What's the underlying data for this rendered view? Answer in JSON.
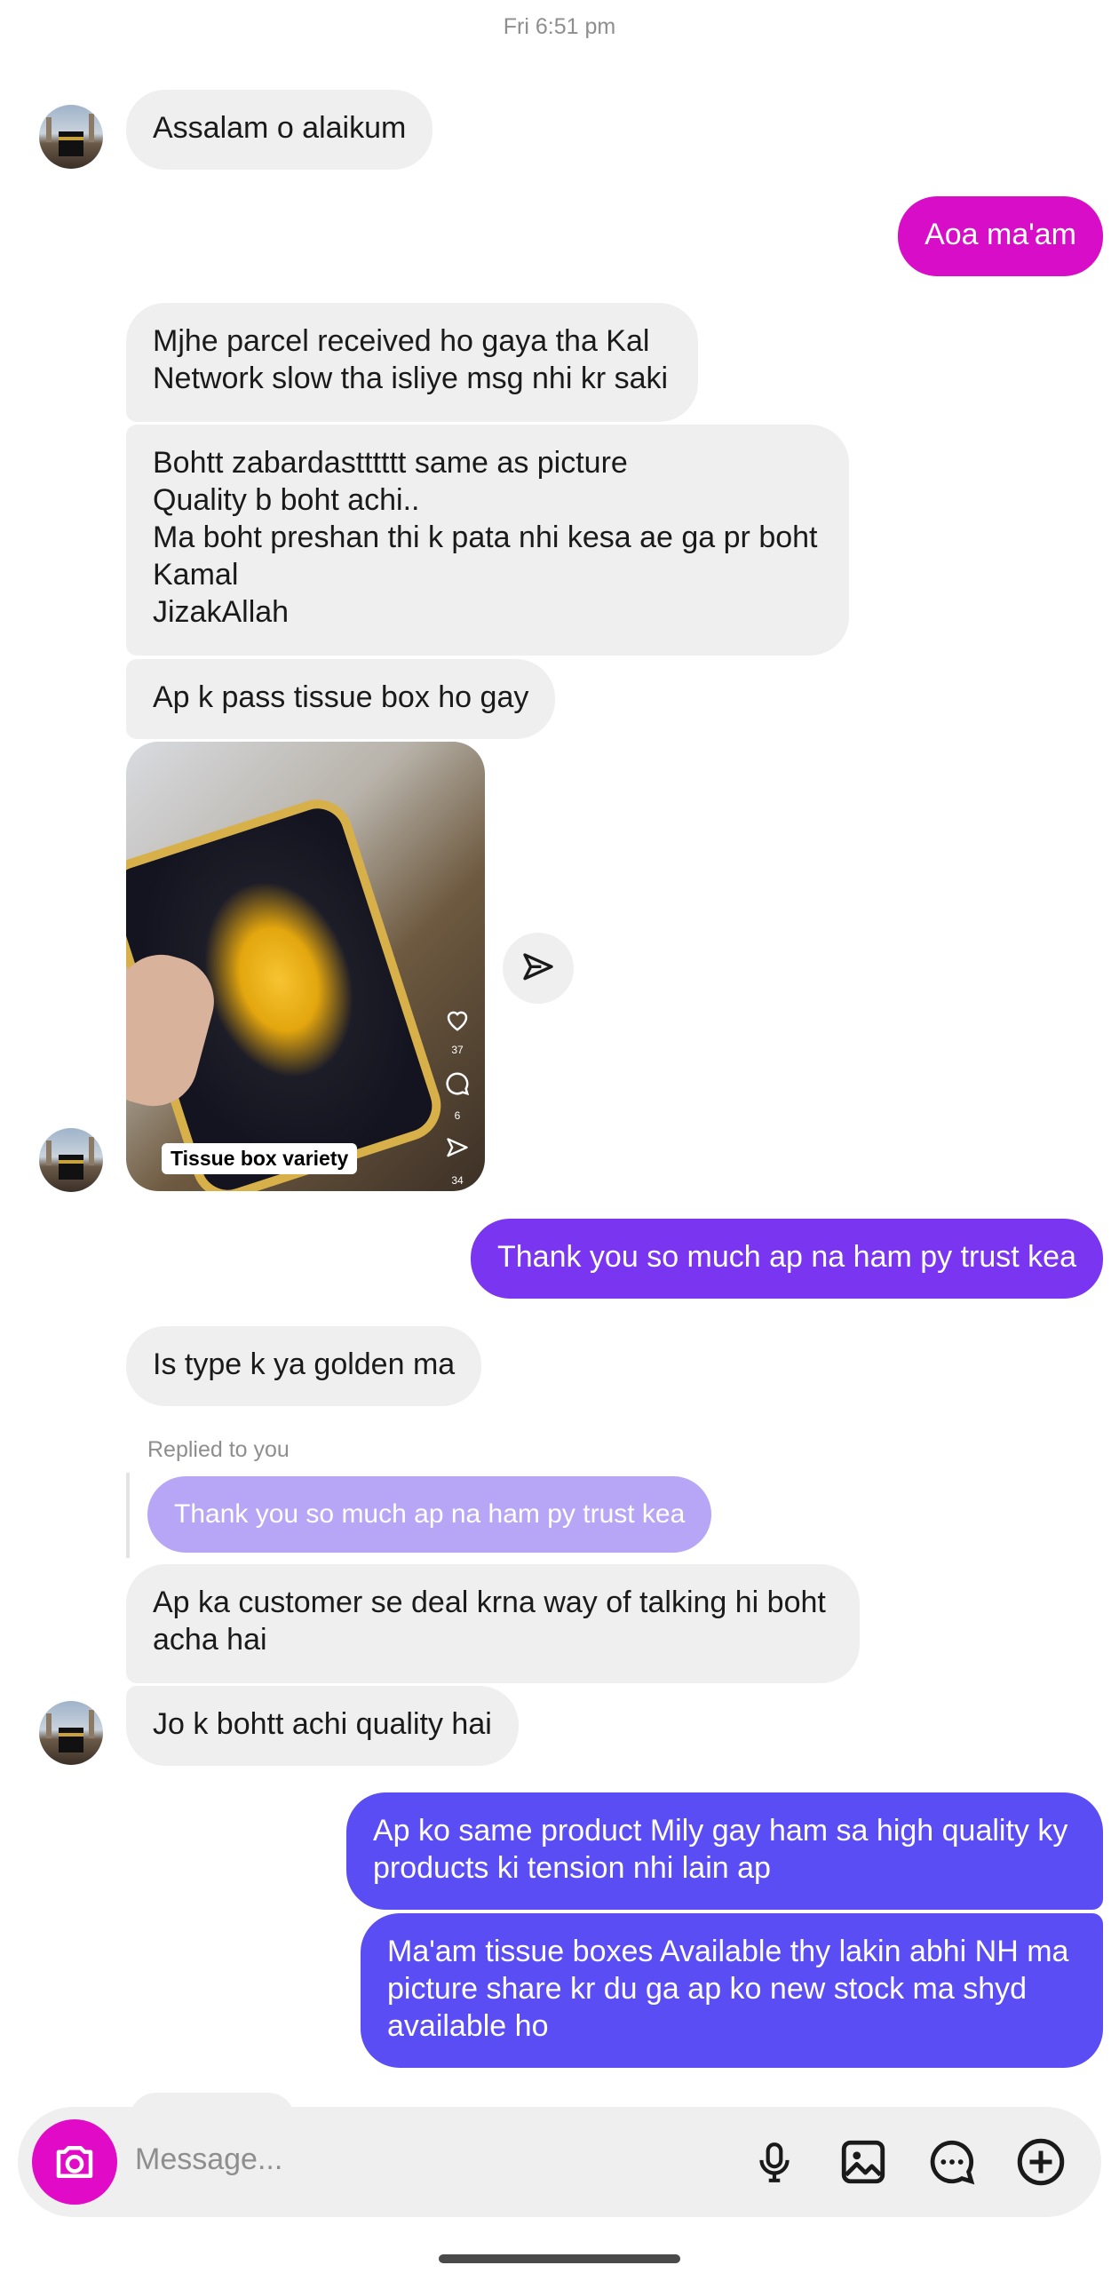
{
  "header": {
    "timestamp": "Fri 6:51 pm"
  },
  "messages": {
    "m1": "Assalam o alaikum",
    "m2": "Aoa ma'am",
    "m3": "Mjhe parcel received ho gaya tha Kal\nNetwork slow tha isliye msg nhi kr saki",
    "m4": "Bohtt zabardastttttt same as picture\nQuality b boht achi..\nMa boht preshan thi k pata nhi kesa ae ga pr boht\nKamal\nJizakAllah",
    "m5": "Ap k pass tissue box ho gay",
    "m6": "Thank you so much ap na ham py trust kea",
    "m7": "Is type k ya golden ma",
    "m8": "Ap ka customer se deal krna way of talking hi boht\nacha hai",
    "m9": "Jo k bohtt achi quality hai",
    "m10": "Ap ko same product Mily gay ham sa high quality ky\nproducts ki tension nhi lain ap",
    "m11": "Ma'am tissue boxes Available thy lakin abhi NH ma\npicture share kr du ga ap ko new stock ma shyd\navailable ho"
  },
  "reel": {
    "caption": "Tissue box  variety",
    "likes": "37",
    "comments": "6",
    "shares": "34"
  },
  "reply": {
    "label": "Replied to you",
    "quoted": "Thank you so much ap na ham py trust kea"
  },
  "composer": {
    "placeholder": "Message..."
  },
  "colors": {
    "incoming": "#efefef",
    "outgoing_magenta": "#d80dc8",
    "outgoing_purple": "#7a35f0",
    "outgoing_blue": "#5b4df4"
  },
  "icons": [
    "camera-icon",
    "send-icon",
    "heart-icon",
    "comment-icon",
    "microphone-icon",
    "gallery-icon",
    "sticker-icon",
    "plus-icon"
  ]
}
